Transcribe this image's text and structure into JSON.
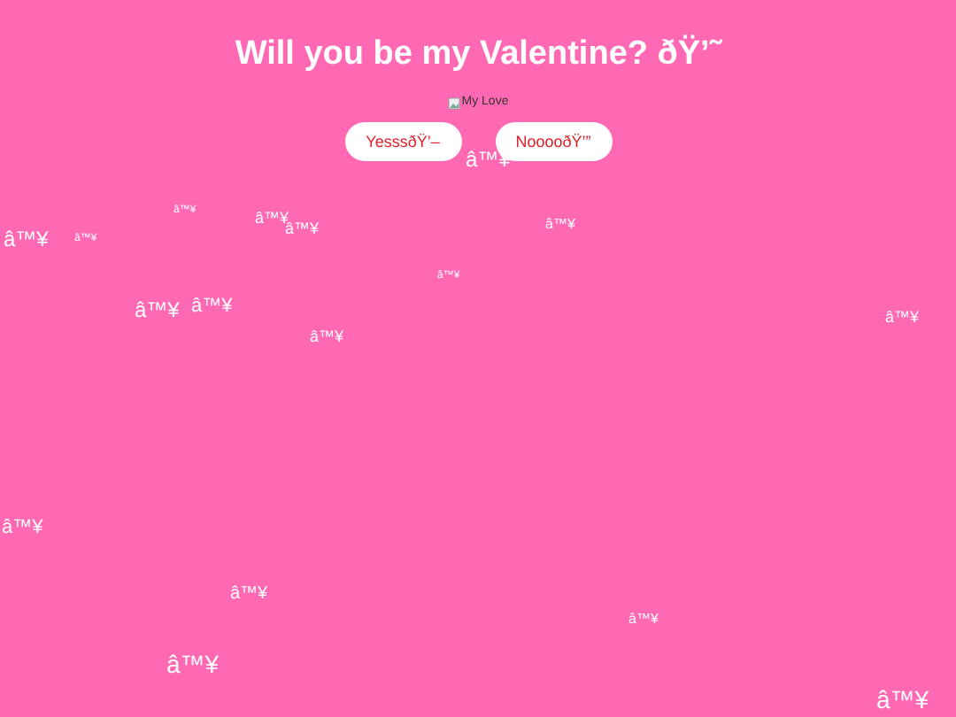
{
  "title": "Will you be my Valentine? ðŸ’˜",
  "image": {
    "alt": "My Love"
  },
  "buttons": [
    {
      "label": "YesssðŸ’–"
    },
    {
      "label": "NooooðŸ’”"
    }
  ],
  "hearts": [
    "â™¥",
    "â™¥",
    "â™¥",
    "â™¥",
    "â™¥",
    "â™¥",
    "â™¥",
    "â™¥",
    "â™¥",
    "â™¥",
    "â™¥",
    "â™¥",
    "â™¥",
    "â™¥",
    "â™¥",
    "â™¥",
    "â™¥"
  ]
}
